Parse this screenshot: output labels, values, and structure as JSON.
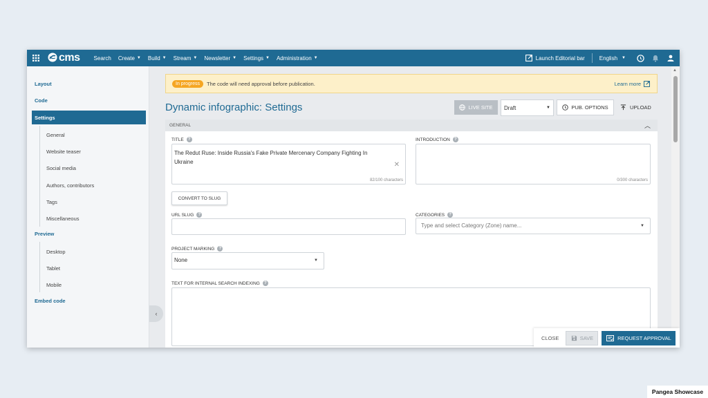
{
  "topbar": {
    "logo": "cms",
    "nav": [
      {
        "label": "Search",
        "dropdown": false
      },
      {
        "label": "Create",
        "dropdown": true
      },
      {
        "label": "Build",
        "dropdown": true
      },
      {
        "label": "Stream",
        "dropdown": true
      },
      {
        "label": "Newsletter",
        "dropdown": true
      },
      {
        "label": "Settings",
        "dropdown": true
      },
      {
        "label": "Administration",
        "dropdown": true
      }
    ],
    "launch_label": "Launch Editorial bar",
    "language": "English",
    "icons": [
      "apps-grid-icon",
      "cms-logo-icon",
      "external-link-icon",
      "clock-icon",
      "bell-icon",
      "user-icon"
    ]
  },
  "sidebar": {
    "items": [
      {
        "label": "Layout"
      },
      {
        "label": "Code"
      },
      {
        "label": "Settings",
        "active": true
      },
      {
        "label": "General"
      },
      {
        "label": "Website teaser"
      },
      {
        "label": "Social media"
      },
      {
        "label": "Authors, contributors"
      },
      {
        "label": "Tags"
      },
      {
        "label": "Miscellaneous"
      },
      {
        "label": "Preview"
      },
      {
        "label": "Desktop"
      },
      {
        "label": "Tablet"
      },
      {
        "label": "Mobile"
      },
      {
        "label": "Embed code"
      }
    ]
  },
  "alert": {
    "badge": "In progress",
    "message": "The code will need approval before publication.",
    "learn_more": "Learn more"
  },
  "header": {
    "title": "Dynamic infographic: Settings",
    "live_site": "LIVE SITE",
    "status": "Draft",
    "pub_options": "PUB. OPTIONS",
    "upload": "UPLOAD"
  },
  "panel": {
    "heading": "GENERAL",
    "title_field": {
      "label": "TITLE",
      "value": "The Redut Ruse: Inside Russia's Fake Private Mercenary Company Fighting In Ukraine",
      "counter": "82/100 characters"
    },
    "introduction_field": {
      "label": "INTRODUCTION",
      "value": "",
      "counter": "0/300 characters"
    },
    "convert_slug": "CONVERT TO SLUG",
    "url_slug": {
      "label": "URL SLUG",
      "value": ""
    },
    "categories": {
      "label": "CATEGORIES",
      "placeholder": "Type and select Category (Zone) name..."
    },
    "project_marking": {
      "label": "PROJECT MARKING",
      "value": "None"
    },
    "search_indexing": {
      "label": "TEXT FOR INTERNAL SEARCH INDEXING",
      "value": ""
    }
  },
  "footer": {
    "close": "CLOSE",
    "save": "SAVE",
    "request_approval": "REQUEST APPROVAL"
  },
  "watermark": "Pangea Showcase",
  "colors": {
    "brand": "#1f6a93",
    "badge": "#f5a623",
    "alert_bg": "#fdf0c9"
  }
}
